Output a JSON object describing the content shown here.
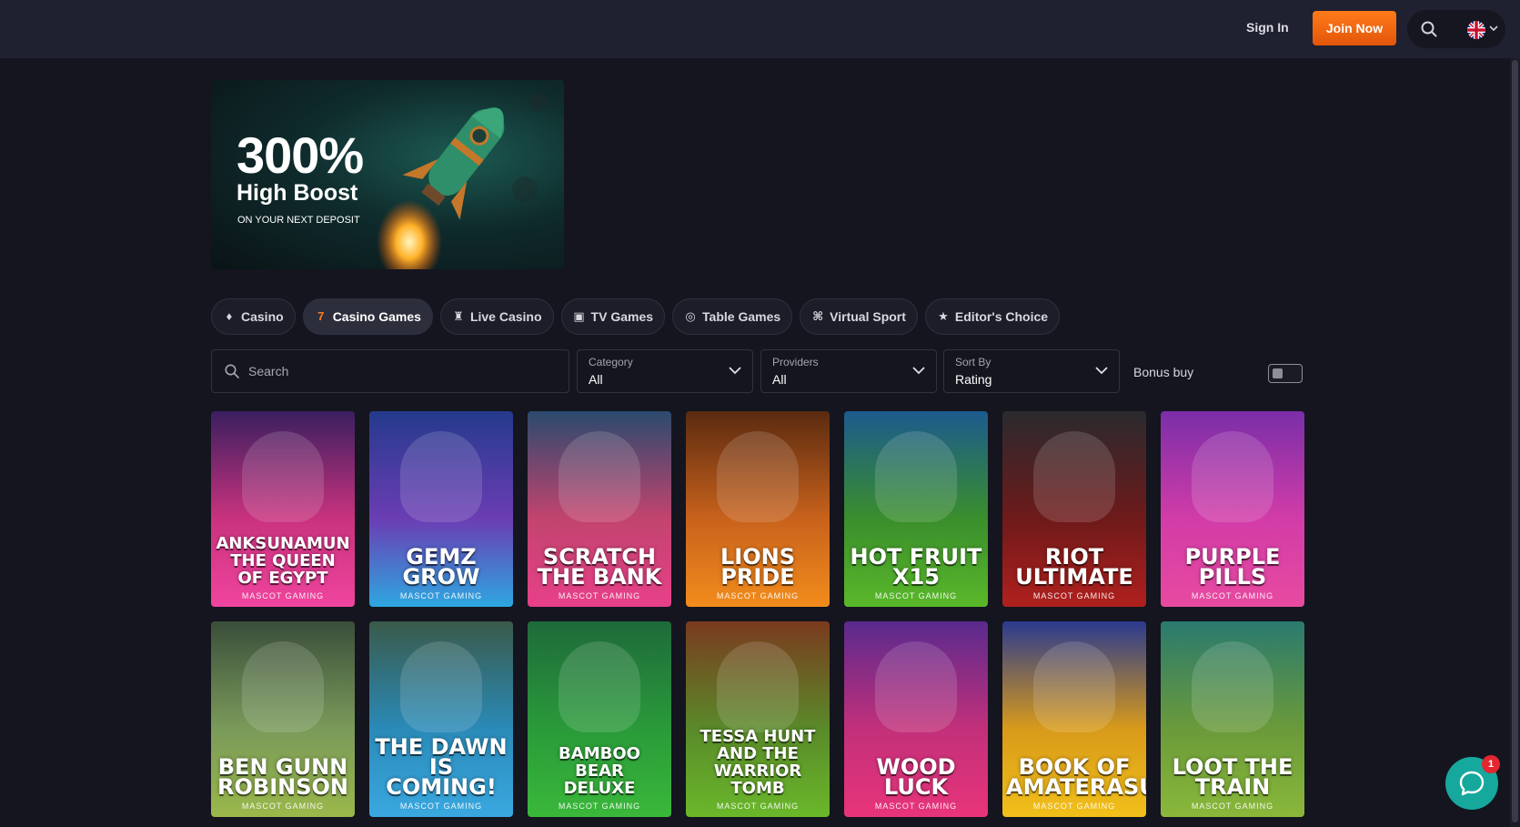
{
  "header": {
    "sign_in": "Sign In",
    "join_now": "Join Now",
    "search_icon": "search-icon",
    "language_flag": "uk-flag-icon"
  },
  "banner": {
    "headline": "300%",
    "subheadline": "High Boost",
    "caption": "ON YOUR NEXT DEPOSIT"
  },
  "tabs": [
    {
      "label": "Casino",
      "icon": "casino-icon",
      "active": false
    },
    {
      "label": "Casino Games",
      "icon": "seven-icon",
      "active": true
    },
    {
      "label": "Live Casino",
      "icon": "live-casino-icon",
      "active": false
    },
    {
      "label": "TV Games",
      "icon": "tv-icon",
      "active": false
    },
    {
      "label": "Table Games",
      "icon": "table-icon",
      "active": false
    },
    {
      "label": "Virtual Sport",
      "icon": "gamepad-icon",
      "active": false
    },
    {
      "label": "Editor's Choice",
      "icon": "star-icon",
      "active": false
    }
  ],
  "filters": {
    "search_placeholder": "Search",
    "category": {
      "label": "Category",
      "value": "All"
    },
    "providers": {
      "label": "Providers",
      "value": "All"
    },
    "sort": {
      "label": "Sort By",
      "value": "Rating"
    },
    "bonus_buy": "Bonus buy",
    "bonus_buy_enabled": false
  },
  "games": [
    {
      "title": "ANKSUNAMUN\nTHE QUEEN\nOF EGYPT",
      "provider": "MASCOT GAMING",
      "colors": [
        "#3a1f5f",
        "#c9327e",
        "#f0449e"
      ]
    },
    {
      "title": "GEMZ\nGROW",
      "provider": "MASCOT GAMING",
      "colors": [
        "#243a8c",
        "#6b3db4",
        "#2ea7e0"
      ]
    },
    {
      "title": "SCRATCH\nTHE BANK",
      "provider": "MASCOT GAMING",
      "colors": [
        "#2a4a6e",
        "#c2446e",
        "#e8408a"
      ]
    },
    {
      "title": "LIONS\nPRIDE",
      "provider": "MASCOT GAMING",
      "colors": [
        "#5a2a10",
        "#c8621c",
        "#f28c1c"
      ]
    },
    {
      "title": "HOT FRUIT\nX15",
      "provider": "MASCOT GAMING",
      "colors": [
        "#1c5a8e",
        "#3a8e2c",
        "#5ab82a"
      ]
    },
    {
      "title": "RIOT\nULTIMATE",
      "provider": "MASCOT GAMING",
      "colors": [
        "#2a2a2e",
        "#6e1a1a",
        "#b0201e"
      ]
    },
    {
      "title": "PURPLE\nPILLS",
      "provider": "MASCOT GAMING",
      "colors": [
        "#7a2ea8",
        "#d23ca8",
        "#e84aa0"
      ]
    },
    {
      "title": "BEN GUNN\nROBINSON",
      "provider": "MASCOT GAMING",
      "colors": [
        "#3a4e3a",
        "#7a9a5a",
        "#9ab84a"
      ]
    },
    {
      "title": "THE DAWN IS\nCOMING!",
      "provider": "MASCOT GAMING",
      "colors": [
        "#3a5a4a",
        "#2a8ab8",
        "#3aa8e0"
      ]
    },
    {
      "title": "BAMBOO\nBEAR\nDELUXE",
      "provider": "MASCOT GAMING",
      "colors": [
        "#1e6a3a",
        "#2a9a3a",
        "#3ab83a"
      ]
    },
    {
      "title": "TESSA HUNT AND THE\nWARRIOR\nTOMB",
      "provider": "MASCOT GAMING",
      "colors": [
        "#7a3a1e",
        "#5a8a2a",
        "#6ab82a"
      ]
    },
    {
      "title": "WOOD\nLUCK",
      "provider": "MASCOT GAMING",
      "colors": [
        "#5a2a8e",
        "#c2307a",
        "#e8347a"
      ]
    },
    {
      "title": "BOOK OF\nAMATERASU",
      "provider": "MASCOT GAMING",
      "colors": [
        "#2a3a8e",
        "#d89a1a",
        "#f2c01a"
      ]
    },
    {
      "title": "LOOT THE\nTRAIN",
      "provider": "MASCOT GAMING",
      "colors": [
        "#2a7a6e",
        "#6a9a3a",
        "#8ab83a"
      ]
    }
  ],
  "chat": {
    "badge_count": "1",
    "icon": "chat-icon"
  }
}
